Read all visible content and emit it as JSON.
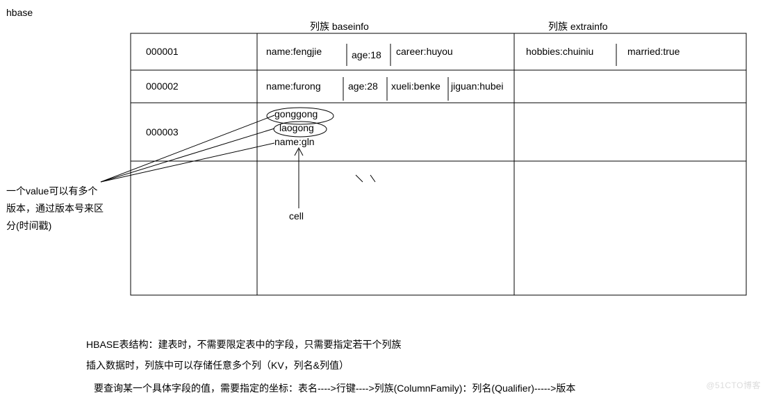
{
  "title": "hbase",
  "headers": {
    "baseinfo": "列族 baseinfo",
    "extrainfo": "列族 extrainfo"
  },
  "rows": {
    "r1": {
      "key": "000001",
      "base": {
        "name": "name:fengjie",
        "age": "age:18",
        "career": "career:huyou"
      },
      "extra": {
        "hobbies": "hobbies:chuiniu",
        "married": "married:true"
      }
    },
    "r2": {
      "key": "000002",
      "base": {
        "name": "name:furong",
        "age": "age:28",
        "xueli": "xueli:benke",
        "jiguan": "jiguan:hubei"
      }
    },
    "r3": {
      "key": "000003",
      "versions": {
        "v1": "gonggong",
        "v2": "laogong",
        "v3": "name:gln"
      }
    }
  },
  "sideNote": "一个value可以有多个\n版本，通过版本号来区\n分(时间戳)",
  "cellLabel": "cell",
  "notes": {
    "n1": "HBASE表结构：建表时，不需要限定表中的字段，只需要指定若干个列族",
    "n2": "插入数据时，列族中可以存储任意多个列（KV，列名&列值）",
    "n3": "要查询某一个具体字段的值，需要指定的坐标：表名---->行键---->列族(ColumnFamily)：列名(Qualifier)----->版本"
  },
  "watermark": "@51CTO博客"
}
